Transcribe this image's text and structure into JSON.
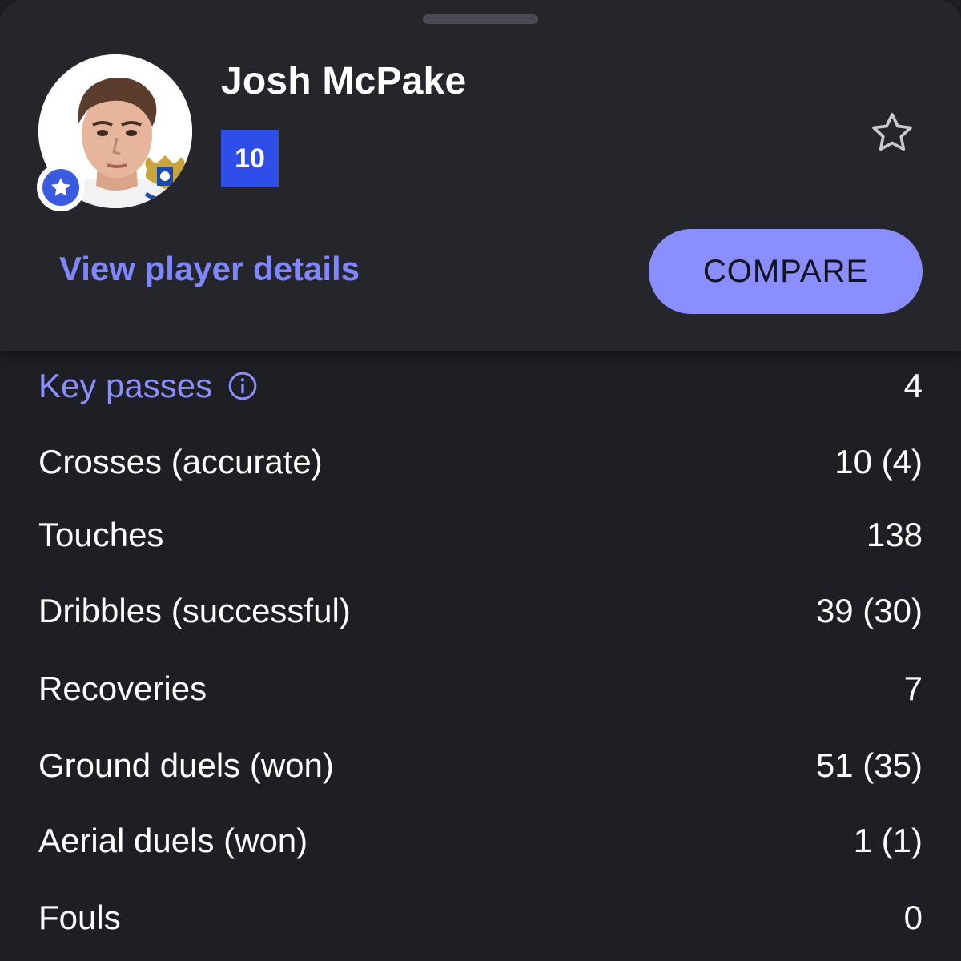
{
  "player": {
    "name": "Josh McPake",
    "shirt_number": "10"
  },
  "actions": {
    "view_details_label": "View player details",
    "compare_label": "COMPARE"
  },
  "colors": {
    "accent": "#8a8eff",
    "number_badge": "#2f4de8",
    "background": "#1e1f24",
    "card": "#25262c"
  },
  "icons": {
    "follow": "star-outline-icon",
    "favorite_badge": "star-badge-icon",
    "info": "info-icon"
  },
  "stats": [
    {
      "label": "Key passes",
      "value": "4",
      "highlight": true,
      "info": true
    },
    {
      "label": "Crosses (accurate)",
      "value": "10 (4)"
    },
    {
      "label": "Touches",
      "value": "138"
    },
    {
      "label": "Dribbles (successful)",
      "value": "39 (30)"
    },
    {
      "label": "Recoveries",
      "value": "7"
    },
    {
      "label": "Ground duels (won)",
      "value": "51 (35)"
    },
    {
      "label": "Aerial duels (won)",
      "value": "1 (1)"
    },
    {
      "label": "Fouls",
      "value": "0"
    }
  ]
}
